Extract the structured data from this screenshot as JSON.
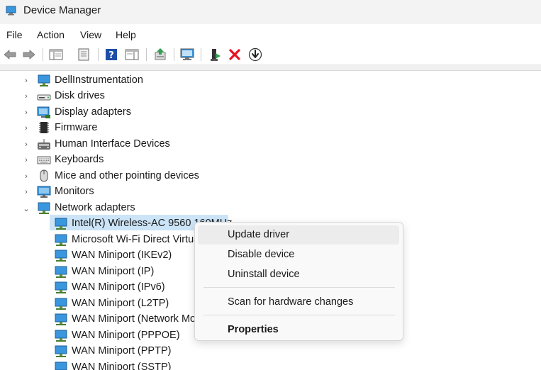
{
  "window": {
    "title": "Device Manager"
  },
  "menu": [
    "File",
    "Action",
    "View",
    "Help"
  ],
  "toolbar": {
    "buttons": [
      "back-icon",
      "forward-icon",
      "show-hide-console-tree-icon",
      "properties-icon",
      "help-icon",
      "action-pane-icon",
      "update-driver-icon",
      "scan-hardware-icon",
      "enable-device-icon",
      "uninstall-device-icon",
      "install-icon"
    ],
    "uninstall_color": "#e81123"
  },
  "tree": {
    "categories": [
      {
        "label": "DellInstrumentation",
        "expanded": false,
        "icon": "monitor-network-icon"
      },
      {
        "label": "Disk drives",
        "expanded": false,
        "icon": "disk-drive-icon"
      },
      {
        "label": "Display adapters",
        "expanded": false,
        "icon": "display-adapter-icon"
      },
      {
        "label": "Firmware",
        "expanded": false,
        "icon": "firmware-icon"
      },
      {
        "label": "Human Interface Devices",
        "expanded": false,
        "icon": "hid-icon"
      },
      {
        "label": "Keyboards",
        "expanded": false,
        "icon": "keyboard-icon"
      },
      {
        "label": "Mice and other pointing devices",
        "expanded": false,
        "icon": "mouse-icon"
      },
      {
        "label": "Monitors",
        "expanded": false,
        "icon": "monitor-icon"
      },
      {
        "label": "Network adapters",
        "expanded": true,
        "icon": "network-adapter-icon"
      }
    ],
    "network_children": [
      {
        "label": "Intel(R) Wireless-AC 9560 160MHz",
        "selected": true
      },
      {
        "label": "Microsoft Wi-Fi Direct Virtual Adapter",
        "selected": false
      },
      {
        "label": "WAN Miniport (IKEv2)",
        "selected": false
      },
      {
        "label": "WAN Miniport (IP)",
        "selected": false
      },
      {
        "label": "WAN Miniport (IPv6)",
        "selected": false
      },
      {
        "label": "WAN Miniport (L2TP)",
        "selected": false
      },
      {
        "label": "WAN Miniport (Network Monitor)",
        "selected": false
      },
      {
        "label": "WAN Miniport (PPPOE)",
        "selected": false
      },
      {
        "label": "WAN Miniport (PPTP)",
        "selected": false
      },
      {
        "label": "WAN Miniport (SSTP)",
        "selected": false
      }
    ]
  },
  "context_menu": {
    "items": [
      {
        "label": "Update driver",
        "highlighted": true,
        "bold": false
      },
      {
        "label": "Disable device",
        "highlighted": false,
        "bold": false
      },
      {
        "label": "Uninstall device",
        "highlighted": false,
        "bold": false
      },
      {
        "label": "Scan for hardware changes",
        "highlighted": false,
        "bold": false
      },
      {
        "label": "Properties",
        "highlighted": false,
        "bold": true
      }
    ]
  },
  "colors": {
    "selection": "#cce4f7",
    "accent": "#0078d4"
  }
}
